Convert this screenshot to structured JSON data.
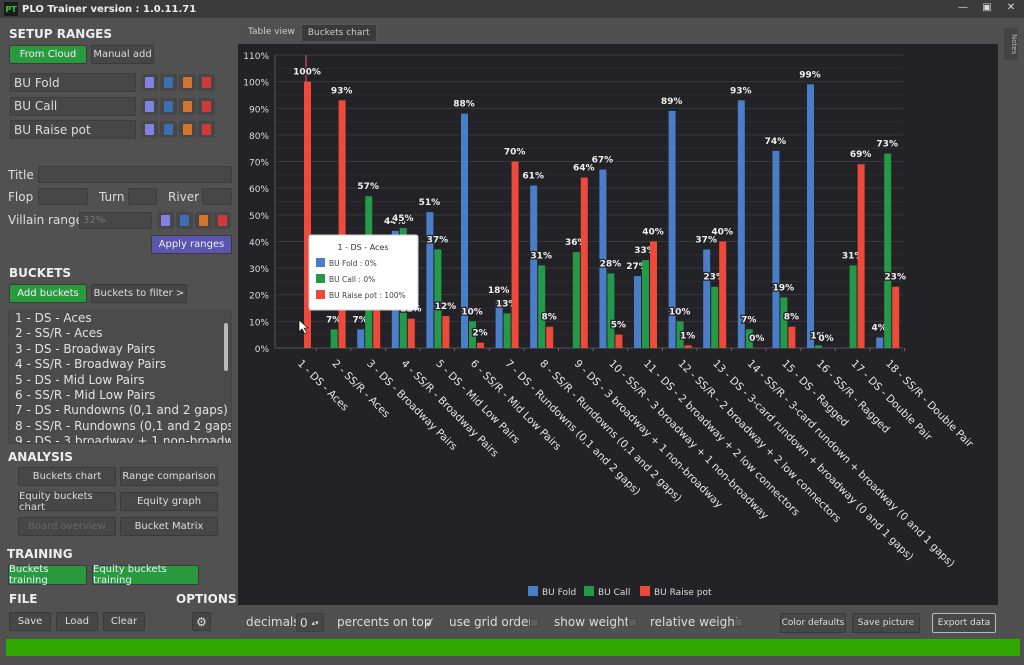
{
  "window": {
    "title": "PLO Trainer version : 1.0.11.71",
    "logo": "PT"
  },
  "setup": {
    "heading": "SETUP RANGES",
    "from_cloud": "From Cloud",
    "manual_add": "Manual add",
    "ranges": [
      "BU Fold",
      "BU Call",
      "BU Raise pot"
    ],
    "title_label": "Title",
    "title_value": "",
    "flop_label": "Flop",
    "turn_label": "Turn",
    "river_label": "River",
    "villain_label": "Villain range",
    "villain_placeholder": "32%",
    "apply": "Apply ranges"
  },
  "buckets": {
    "heading": "BUCKETS",
    "add": "Add buckets",
    "filter": "Buckets to filter >",
    "items": [
      "1 - DS - Aces",
      "2 - SS/R - Aces",
      "3 - DS - Broadway Pairs",
      "4 - SS/R - Broadway Pairs",
      "5 - DS - Mid Low Pairs",
      "6 - SS/R - Mid Low Pairs",
      "7 - DS - Rundowns (0,1 and 2 gaps)",
      "8 - SS/R - Rundowns (0,1 and 2 gaps)",
      "9 - DS - 3 broadway + 1 non-broadway"
    ]
  },
  "analysis": {
    "heading": "ANALYSIS",
    "buckets_chart": "Buckets chart",
    "range_comparison": "Range comparison",
    "equity_buckets_chart": "Equity buckets chart",
    "equity_graph": "Equity graph",
    "board_overview": "Board overview",
    "bucket_matrix": "Bucket Matrix"
  },
  "training": {
    "heading": "TRAINING",
    "buckets_training": "Buckets training",
    "equity_buckets_training": "Equity buckets training"
  },
  "file": {
    "heading": "FILE",
    "save": "Save",
    "load": "Load",
    "clear": "Clear"
  },
  "options": {
    "heading": "OPTIONS",
    "icon": "gear-icon"
  },
  "tabs": [
    "Table view",
    "Buckets chart"
  ],
  "notes": "Notes",
  "tooltip": {
    "title": "1 - DS - Aces",
    "lines": [
      "BU Fold : 0%",
      "BU Call : 0%",
      "BU Raise pot : 100%"
    ]
  },
  "controls": {
    "decimals_label": "decimals",
    "decimals": "0",
    "percents_on_top": "percents on top",
    "percents_on_top_checked": true,
    "use_grid_order": "use grid order",
    "show_weight": "show weight",
    "relative_weight": "relative weight",
    "color_defaults": "Color defaults",
    "save_picture": "Save picture",
    "export_data": "Export data"
  },
  "progress": 1.0,
  "chart_data": {
    "type": "bar",
    "ylim": [
      0,
      110
    ],
    "grid": true,
    "legend": "bottom",
    "yticks": [
      "0%",
      "10%",
      "20%",
      "30%",
      "40%",
      "50%",
      "60%",
      "70%",
      "80%",
      "90%",
      "100%",
      "110%"
    ],
    "categories": [
      "1 - DS - Aces",
      "2 - SS/R - Aces",
      "3 - DS - Broadway Pairs",
      "4 - SS/R - Broadway Pairs",
      "5 - DS - Mid Low Pairs",
      "6 - SS/R - Mid Low Pairs",
      "7 - DS - Rundowns (0,1 and 2 gaps)",
      "8 - SS/R - Rundowns (0,1 and 2 gaps)",
      "9 - DS - 3 broadway + 1 non-broadway",
      "10 - SS/R - 3 broadway + 1 non-broadway",
      "11 - DS - 2 broadway + 2 low connectors",
      "12 - SS/R - 2 broadway + 2 low connectors",
      "13 - DS - 3-card rundown + broadway (0 and 1 gaps)",
      "14 - SS/R - 3-card rundown + broadway (0 and 1 gaps)",
      "15 - DS - Ragged",
      "16 - SS/R - Ragged",
      "17 - DS - Double Pair",
      "18 - SS/R - Double Pair"
    ],
    "series": [
      {
        "name": "BU Fold",
        "color": "#4a7ec8",
        "values": [
          0,
          0,
          7,
          44,
          51,
          88,
          18,
          61,
          0,
          67,
          27,
          89,
          37,
          93,
          74,
          99,
          0,
          4
        ]
      },
      {
        "name": "BU Call",
        "color": "#249a48",
        "values": [
          0,
          7,
          57,
          45,
          37,
          10,
          13,
          31,
          36,
          28,
          33,
          10,
          23,
          7,
          19,
          1,
          31,
          73
        ]
      },
      {
        "name": "BU Raise pot",
        "color": "#ee4a3c",
        "values": [
          100,
          93,
          36,
          11,
          12,
          2,
          70,
          8,
          64,
          5,
          40,
          1,
          40,
          0,
          8,
          0,
          69,
          23
        ]
      }
    ]
  }
}
